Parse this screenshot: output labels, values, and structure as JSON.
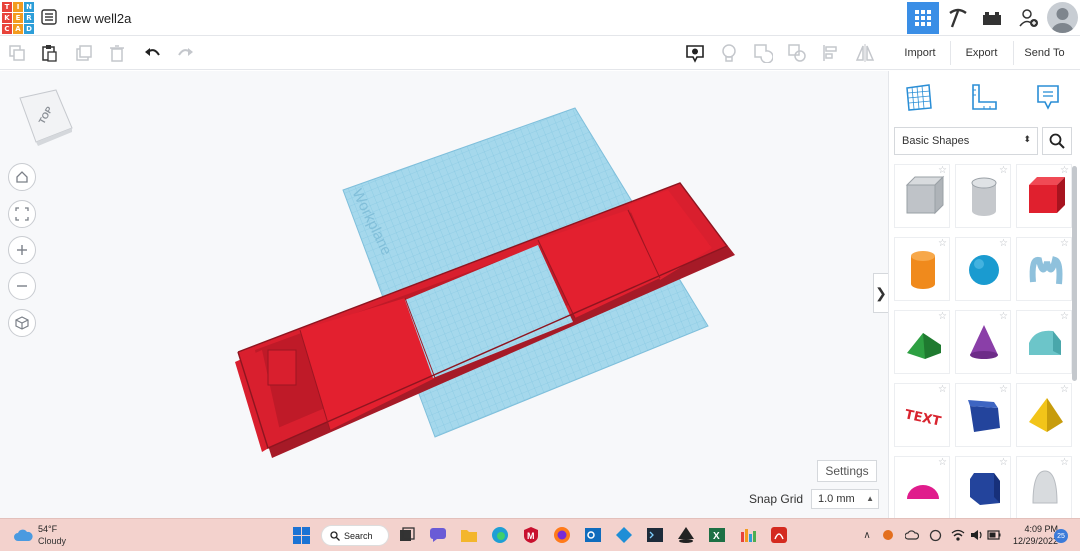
{
  "header": {
    "logo_letters": [
      "T",
      "I",
      "N",
      "K",
      "E",
      "R",
      "C",
      "A",
      "D"
    ],
    "logo_colors": [
      "#e8433a",
      "#f39b1f",
      "#2d9ed8",
      "#e8433a",
      "#f39b1f",
      "#2d9ed8",
      "#e8433a",
      "#f39b1f",
      "#2d9ed8"
    ],
    "doc_title": "new well2a",
    "icons": [
      "grid-view-icon",
      "pickaxe-icon",
      "bricks-icon",
      "add-user-icon",
      "avatar"
    ]
  },
  "toolbar": {
    "left_icons": [
      "copy-icon",
      "paste-icon",
      "duplicate-icon",
      "delete-icon",
      "undo-icon",
      "redo-icon"
    ],
    "right_icons": [
      "notes-visibility-icon",
      "light-bulb-icon",
      "group-icon",
      "ungroup-icon",
      "align-icon",
      "mirror-icon"
    ],
    "import_label": "Import",
    "export_label": "Export",
    "send_to_label": "Send To"
  },
  "viewport": {
    "view_cube_label": "TOP",
    "workplane_label": "Workplane",
    "settings_label": "Settings",
    "snap_grid_label": "Snap Grid",
    "snap_grid_value": "1.0 mm",
    "colors": {
      "workplane": "#9bd3ea",
      "shape": "#e02232"
    }
  },
  "panel": {
    "tabs": [
      "workplane-icon",
      "ruler-icon",
      "notes-icon"
    ],
    "shape_category": "Basic Shapes",
    "shapes": [
      {
        "name": "box-hole",
        "color": "#bfc3c8"
      },
      {
        "name": "cylinder-hole",
        "color": "#c5c8cc"
      },
      {
        "name": "box",
        "color": "#e0202e"
      },
      {
        "name": "cylinder",
        "color": "#f08a1c"
      },
      {
        "name": "sphere",
        "color": "#1a9bd0"
      },
      {
        "name": "scribble",
        "color": "#8fc1dc"
      },
      {
        "name": "roof",
        "color": "#2ea043"
      },
      {
        "name": "cone",
        "color": "#8a3fa8"
      },
      {
        "name": "round-roof",
        "color": "#6cc5c9"
      },
      {
        "name": "text",
        "color": "#d8242f"
      },
      {
        "name": "wedge",
        "color": "#23449c"
      },
      {
        "name": "pyramid",
        "color": "#f2c419"
      },
      {
        "name": "half-sphere",
        "color": "#e01c8c"
      },
      {
        "name": "polygon",
        "color": "#23449c"
      },
      {
        "name": "paraboloid",
        "color": "#d8dbde"
      }
    ]
  },
  "taskbar": {
    "weather_temp": "54°F",
    "weather_desc": "Cloudy",
    "search_label": "Search",
    "apps": [
      "windows-start-icon",
      "task-view-icon",
      "chat-icon",
      "file-explorer-icon",
      "edge-icon",
      "mcafee-icon",
      "firefox-icon",
      "outlook-icon",
      "app-icon",
      "terminal-icon",
      "inkscape-icon",
      "excel-icon",
      "app2-icon",
      "acrobat-icon"
    ],
    "clock_time": "4:09 PM",
    "clock_date": "12/29/2022",
    "notification_count": "25"
  }
}
